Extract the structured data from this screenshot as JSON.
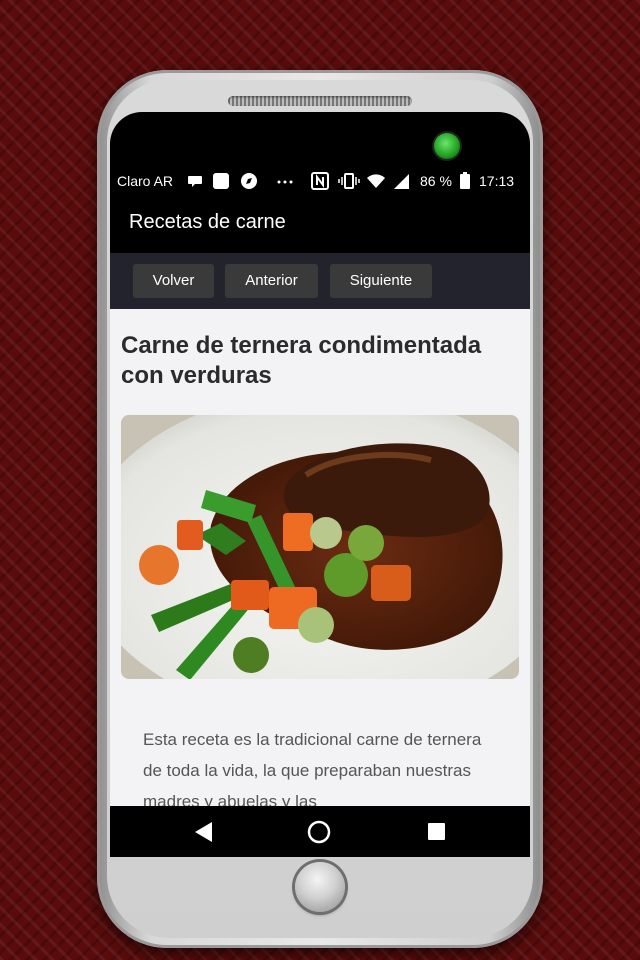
{
  "status_bar": {
    "carrier": "Claro AR",
    "battery_percent": "86 %",
    "time": "17:13",
    "icons": [
      "chat-bubble-icon",
      "square-notification-icon",
      "compass-icon",
      "more-dots-icon",
      "nfc-icon",
      "vibrate-icon",
      "wifi-icon",
      "signal-icon",
      "battery-icon"
    ]
  },
  "app_bar": {
    "title": "Recetas de carne"
  },
  "toolbar": {
    "back_label": "Volver",
    "previous_label": "Anterior",
    "next_label": "Siguiente"
  },
  "recipe": {
    "title": "Carne de ternera condimentada con verduras",
    "image_alt": "photo of beef with sauce and vegetables",
    "intro_text": "Esta receta es la tradicional carne de ternera de toda la vida, la que preparaban nuestras madres y abuelas y las"
  },
  "nav_bar": {
    "icons": [
      "back-triangle-icon",
      "home-circle-icon",
      "recents-square-icon"
    ]
  },
  "colors": {
    "background": "#5a0c0c",
    "app_bar": "#000000",
    "toolbar": "#23232d",
    "button": "#3a3a3a",
    "page": "#f3f3f6",
    "led": "#22a622"
  }
}
